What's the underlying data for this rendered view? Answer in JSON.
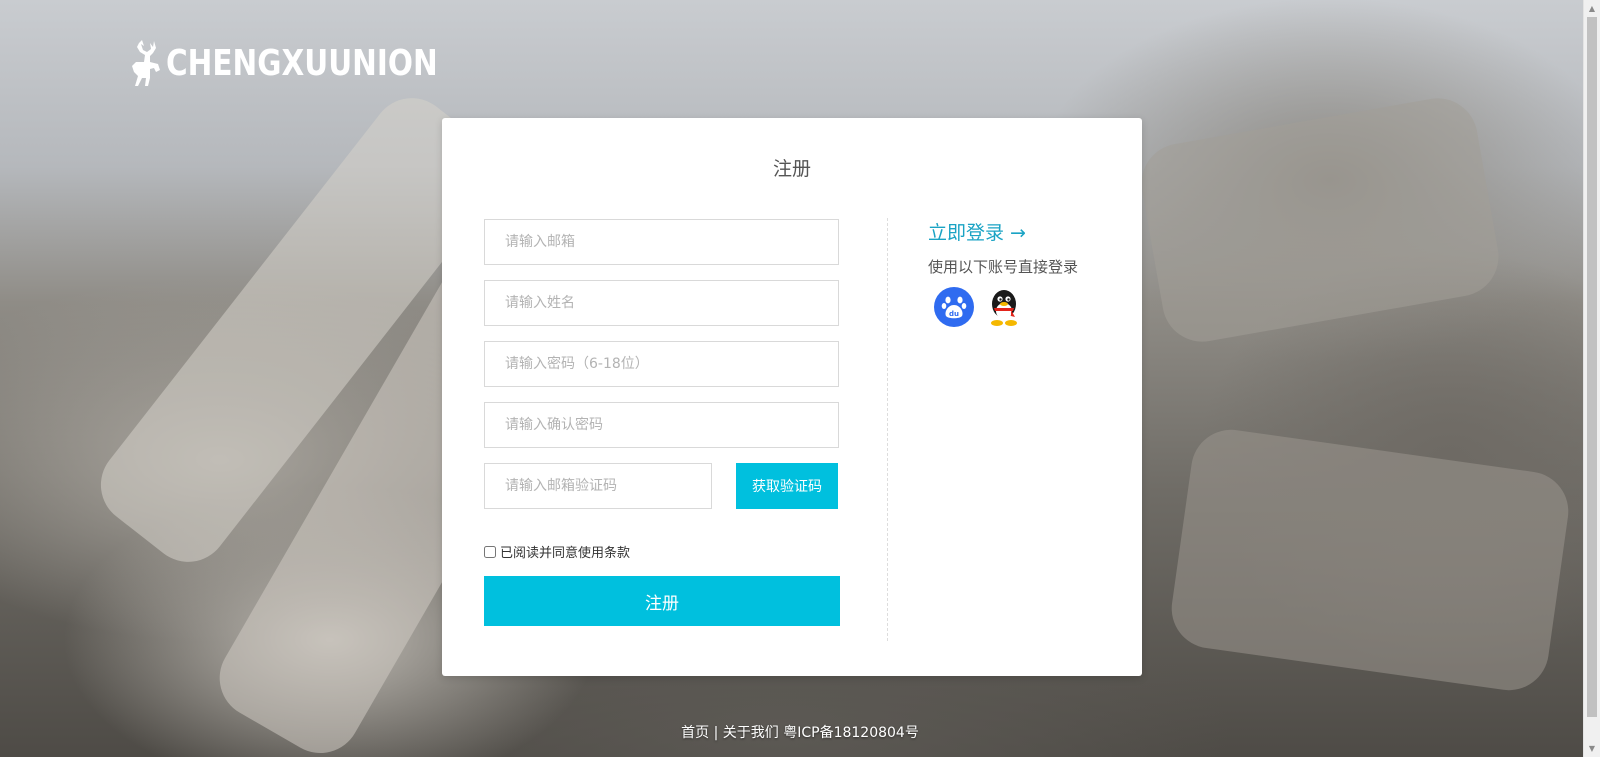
{
  "logo": {
    "text": "CHENGXUUNION"
  },
  "register": {
    "title": "注册",
    "email_placeholder": "请输入邮箱",
    "name_placeholder": "请输入姓名",
    "password_placeholder": "请输入密码（6-18位）",
    "confirm_placeholder": "请输入确认密码",
    "code_placeholder": "请输入邮箱验证码",
    "get_code_label": "获取验证码",
    "agree_label": "已阅读并同意使用条款",
    "agree_checked": false,
    "submit_label": "注册"
  },
  "side": {
    "login_link": "立即登录 →",
    "hint": "使用以下账号直接登录",
    "social_icons": [
      "baidu-icon",
      "qq-icon"
    ]
  },
  "footer": {
    "home": "首页",
    "sep1": " | ",
    "about": "关于我们",
    "icp": " 粤ICP备18120804号"
  },
  "colors": {
    "accent": "#00c0de",
    "link": "#1aa3c4",
    "baidu": "#2f6bf0"
  }
}
